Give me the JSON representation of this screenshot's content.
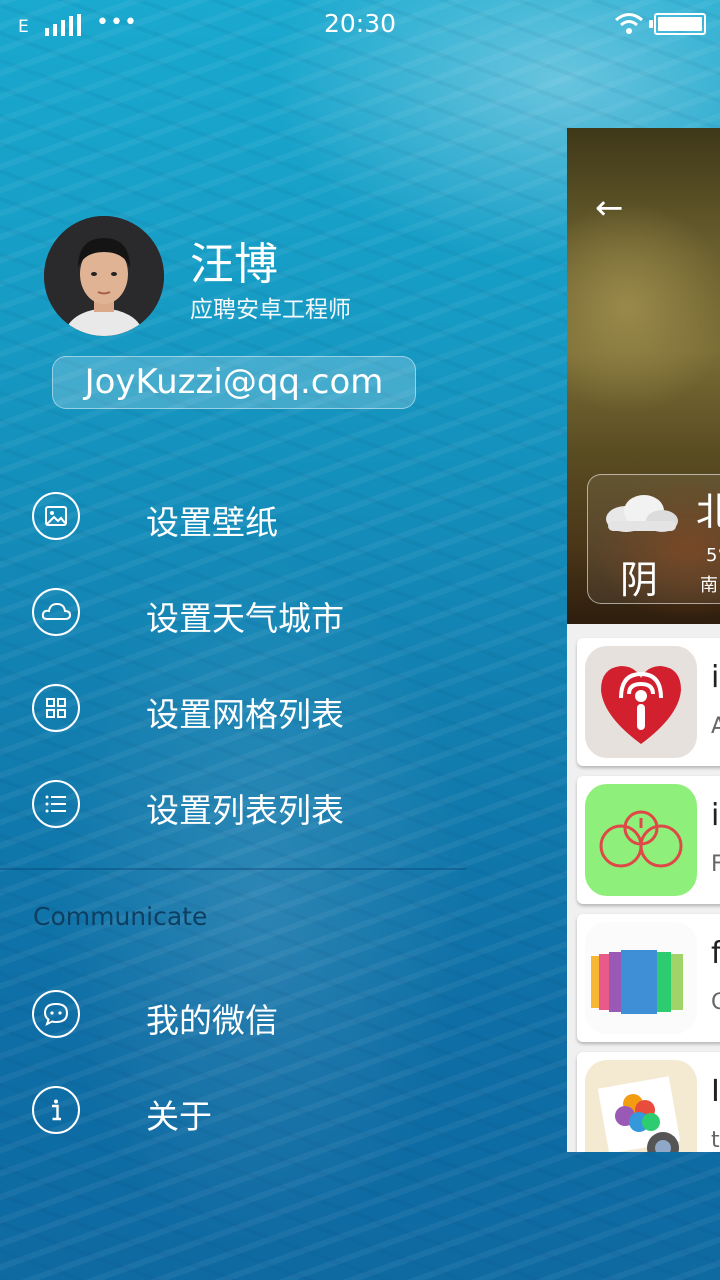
{
  "status_bar": {
    "network": "E",
    "more_dots": "•••",
    "time": "20:30"
  },
  "profile": {
    "name": "汪博",
    "job_title": "应聘安卓工程师",
    "email": "JoyKuzzi@qq.com"
  },
  "menu": {
    "items": [
      {
        "label": "设置壁纸",
        "icon": "wallpaper-icon"
      },
      {
        "label": "设置天气城市",
        "icon": "cloud-icon"
      },
      {
        "label": "设置网格列表",
        "icon": "grid-icon"
      },
      {
        "label": "设置列表列表",
        "icon": "list-icon"
      }
    ],
    "section_title": "Communicate",
    "communicate_items": [
      {
        "label": "我的微信",
        "icon": "wechat-icon"
      },
      {
        "label": "关于",
        "icon": "info-icon"
      }
    ]
  },
  "content_panel": {
    "back_icon": "back-arrow-icon",
    "weather": {
      "condition": "阴",
      "city": "北",
      "temperature": "5°",
      "wind": "南"
    },
    "cards": [
      {
        "title": "i",
        "subtitle": "A"
      },
      {
        "title": "i",
        "subtitle": "F"
      },
      {
        "title": "f",
        "subtitle": "C"
      },
      {
        "title": "I",
        "subtitle": "t"
      }
    ]
  }
}
